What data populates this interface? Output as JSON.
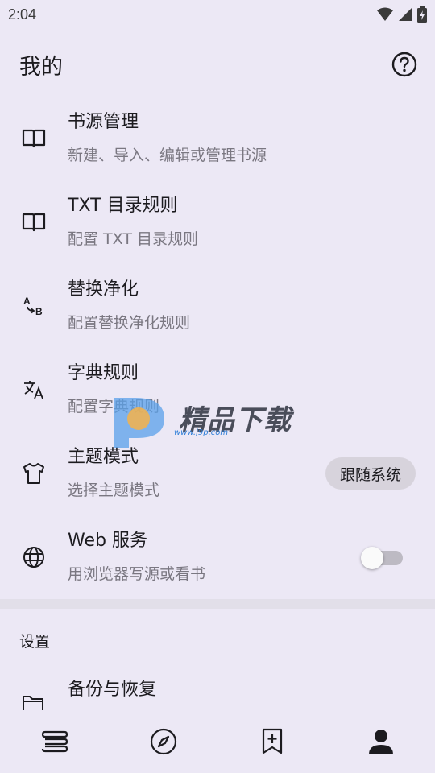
{
  "status_bar": {
    "time": "2:04"
  },
  "header": {
    "title": "我的"
  },
  "items": [
    {
      "title": "书源管理",
      "subtitle": "新建、导入、编辑或管理书源"
    },
    {
      "title": "TXT 目录规则",
      "subtitle": "配置 TXT 目录规则"
    },
    {
      "title": "替换净化",
      "subtitle": "配置替换净化规则"
    },
    {
      "title": "字典规则",
      "subtitle": "配置字典规则"
    },
    {
      "title": "主题模式",
      "subtitle": "选择主题模式",
      "chip": "跟随系统"
    },
    {
      "title": "Web 服务",
      "subtitle": "用浏览器写源或看书",
      "toggle_on": false
    }
  ],
  "settings": {
    "header": "设置",
    "items": [
      {
        "title": "备份与恢复"
      }
    ]
  },
  "watermark": {
    "text": "精品下载",
    "url": "www.j9p.com"
  },
  "colors": {
    "background": "#ece8f5",
    "subtitle": "#7a7781",
    "chip": "#d7d3dc"
  }
}
